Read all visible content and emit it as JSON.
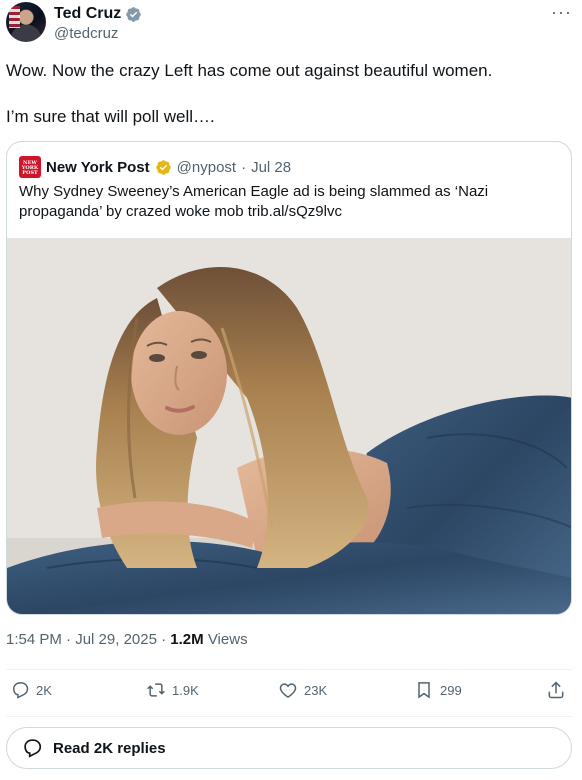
{
  "author": {
    "name": "Ted Cruz",
    "handle": "@tedcruz",
    "verified_color": "#829aab",
    "more_label": "···"
  },
  "tweet": {
    "line1": "Wow. Now the crazy Left has come out against beautiful women.",
    "line2": "I’m sure that will poll well…."
  },
  "quote": {
    "logo_text": "NEW YORK POST",
    "name": "New York Post",
    "handle": "@nypost",
    "separator": "·",
    "date": "Jul 28",
    "verified_color": "#e2b719",
    "text": "Why Sydney Sweeney’s American Eagle ad is being slammed as ‘Nazi propaganda’ by crazed woke mob trib.al/sQz9lvc"
  },
  "meta": {
    "time": "1:54 PM",
    "date": "Jul 29, 2025",
    "views_count": "1.2M",
    "views_label": "Views",
    "sep": "·"
  },
  "actions": {
    "reply_count": "2K",
    "repost_count": "1.9K",
    "like_count": "23K",
    "bookmark_count": "299"
  },
  "read_replies": {
    "label": "Read 2K replies"
  },
  "colors": {
    "text_primary": "#0f1419",
    "text_secondary": "#536471",
    "border": "#cfd9de",
    "nyp_red": "#d2142a"
  }
}
